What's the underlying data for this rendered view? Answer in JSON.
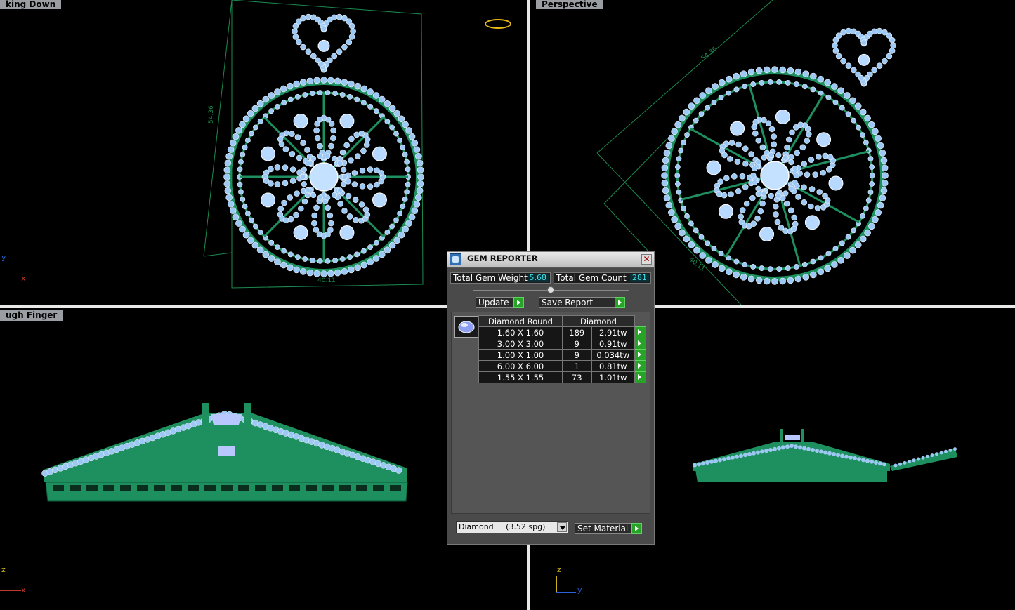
{
  "viewports": {
    "top_left": {
      "label": "king Down",
      "dimension_height": "54.36",
      "dimension_width": "40.11",
      "axis_y": "y",
      "axis_x": "x"
    },
    "top_right": {
      "label": "Perspective",
      "dimension_diag": "54.36",
      "dimension_width": "40.11"
    },
    "bottom_left": {
      "label": "ugh Finger",
      "axis_z": "z",
      "axis_x": "x"
    },
    "bottom_right": {
      "axis_z": "z",
      "axis_y": "y"
    }
  },
  "panel": {
    "title": "GEM REPORTER",
    "close_icon": "close-icon",
    "total_weight_label": "Total Gem Weight",
    "total_weight_value": "5.68",
    "total_count_label": "Total Gem Count",
    "total_count_value": "281",
    "update_label": "Update",
    "save_report_label": "Save Report",
    "table_headers": [
      "Diamond Round",
      "Diamond"
    ],
    "rows": [
      {
        "size": "1.60 X 1.60",
        "count": "189",
        "weight": "2.91tw"
      },
      {
        "size": "3.00 X 3.00",
        "count": "9",
        "weight": "0.91tw"
      },
      {
        "size": "1.00 X 1.00",
        "count": "9",
        "weight": "0.034tw"
      },
      {
        "size": "6.00 X 6.00",
        "count": "1",
        "weight": "0.81tw"
      },
      {
        "size": "1.55 X 1.55",
        "count": "73",
        "weight": "1.01tw"
      }
    ],
    "material_select": "Diamond     (3.52 spg)",
    "set_material_label": "Set Material"
  },
  "colors": {
    "gem": "#9ec8f4",
    "metal": "#1e8f5e",
    "dim_line": "#1c8a4e",
    "value_text": "#41e0e8",
    "go_button": "#27a327"
  }
}
